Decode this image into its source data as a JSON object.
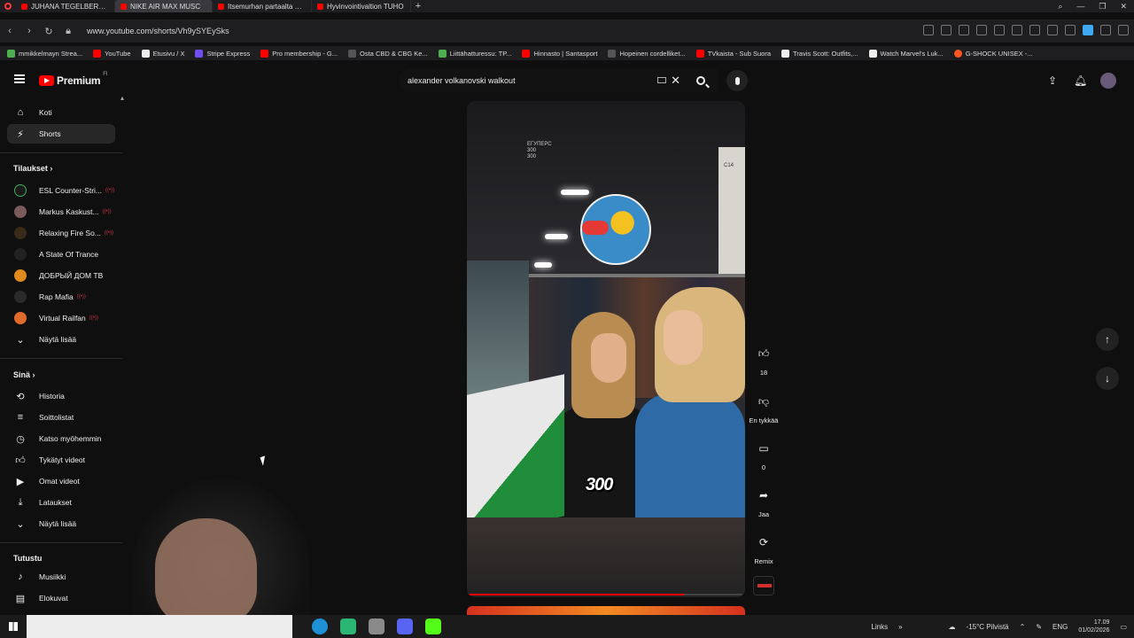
{
  "browser": {
    "tabs": [
      {
        "label": "JUHANA TEGELBERG AAS"
      },
      {
        "label": "NIKE AIR MAX MUSC",
        "active": true
      },
      {
        "label": "Itsemurhan partaalta Egyp"
      },
      {
        "label": "Hyvinvointivaltion TUHO"
      }
    ],
    "url": "www.youtube.com/shorts/Vh9ySYEySks",
    "bookmarks": [
      "mmikkelmayn Strea...",
      "YouTube",
      "Etusivu / X",
      "Stripe Express",
      "Pro membership - G...",
      "Osta CBD & CBG Ke...",
      "Liittähatturessu: TP...",
      "Hinnasto | Santasport",
      "Hopeinen cordelliket...",
      "TVkaista - Sub Suora",
      "Travis Scott: Outfits,...",
      "Watch Marvel's Luk...",
      "G-SHOCK UNISEX -..."
    ]
  },
  "header": {
    "logo_text": "Premium",
    "logo_sup": "FI",
    "search_value": "alexander volkanovski walkout"
  },
  "sidebar": {
    "main": [
      {
        "label": "Koti",
        "icon": "home-icon"
      },
      {
        "label": "Shorts",
        "icon": "shorts-icon",
        "active": true
      }
    ],
    "subscriptions_title": "Tilaukset",
    "subscriptions": [
      {
        "label": "ESL Counter-Stri...",
        "color": "#1a1a1a"
      },
      {
        "label": "Markus Kaskust...",
        "color": "#7a5a5a"
      },
      {
        "label": "Relaxing Fire So...",
        "color": "#3a2a1a"
      },
      {
        "label": "A State Of Trance",
        "color": "#222222"
      },
      {
        "label": "ДОБРЫЙ ДОМ ТВ",
        "color": "#e08a1e"
      },
      {
        "label": "Rap Mafia",
        "color": "#2a2a2a"
      },
      {
        "label": "Virtual Railfan",
        "color": "#e06a2a"
      }
    ],
    "subscriptions_more": "Näytä lisää",
    "you_title": "Sinä",
    "you": [
      {
        "label": "Historia",
        "icon": "history-icon"
      },
      {
        "label": "Soittolistat",
        "icon": "playlists-icon"
      },
      {
        "label": "Katso myöhemmin",
        "icon": "watch-later-icon"
      },
      {
        "label": "Tykätyt videot",
        "icon": "liked-videos-icon"
      },
      {
        "label": "Omat videot",
        "icon": "your-videos-icon"
      },
      {
        "label": "Lataukset",
        "icon": "downloads-icon"
      }
    ],
    "you_more": "Näytä lisää",
    "explore_title": "Tutustu",
    "explore": [
      {
        "label": "Musiikki",
        "icon": "music-icon"
      },
      {
        "label": "Elokuvat",
        "icon": "movies-icon"
      }
    ]
  },
  "short": {
    "caption": "300",
    "overlay_text": "ЕГУПЕРС\n300\n300",
    "sign": "C14",
    "progress": 0.78
  },
  "actions": {
    "like_count": "18",
    "dislike_label": "En tykkää",
    "comments_count": "0",
    "share_label": "Jaa",
    "remix_label": "Remix"
  },
  "taskbar": {
    "links_label": "Links",
    "weather": "-15°C Pilvistä",
    "lang": "ENG",
    "time": "17.09",
    "date": "01/02/2026"
  }
}
